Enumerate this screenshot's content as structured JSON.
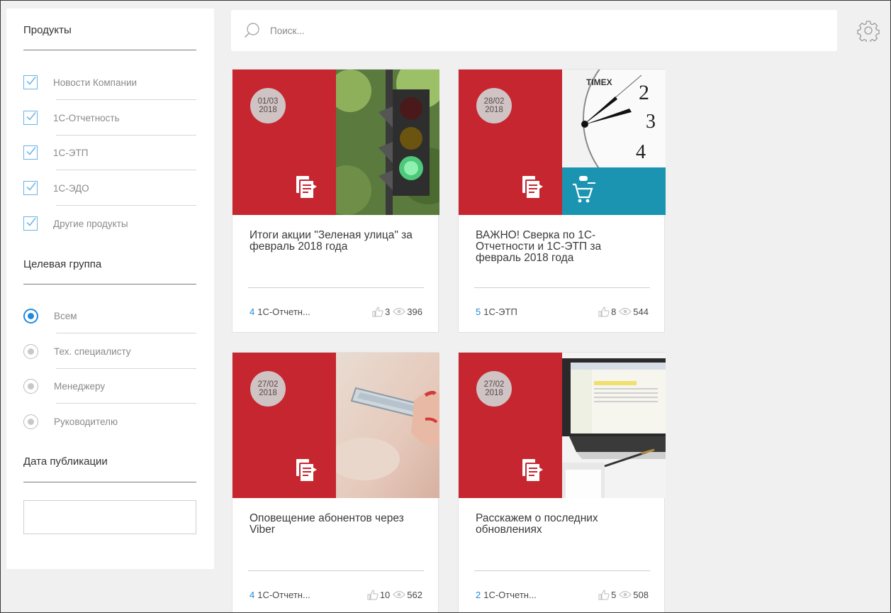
{
  "filters": {
    "products": {
      "title": "Продукты",
      "items": [
        {
          "label": "Новости Компании",
          "checked": true
        },
        {
          "label": "1С-Отчетность",
          "checked": true
        },
        {
          "label": "1С-ЭТП",
          "checked": true
        },
        {
          "label": "1С-ЭДО",
          "checked": true
        },
        {
          "label": "Другие продукты",
          "checked": true
        }
      ]
    },
    "audience": {
      "title": "Целевая группа",
      "options": [
        {
          "label": "Всем",
          "selected": true
        },
        {
          "label": "Тех. специалисту",
          "selected": false
        },
        {
          "label": "Менеджеру",
          "selected": false
        },
        {
          "label": "Руководителю",
          "selected": false
        }
      ]
    },
    "date": {
      "title": "Дата публикации",
      "value": ""
    }
  },
  "search": {
    "placeholder": "Поиск..."
  },
  "icons": {
    "search": "search-icon",
    "settings": "gear-icon",
    "document": "document-icon",
    "cart": "cart-icon",
    "like": "thumbs-up-icon",
    "views": "eye-icon"
  },
  "colors": {
    "card_red": "#c6262f",
    "accent": "#2289e0",
    "cart_teal": "#1a94b0"
  },
  "cards": [
    {
      "day": "01/03",
      "year": "2018",
      "title": "Итоги акции \"Зеленая улица\" за февраль 2018 года",
      "count": "4",
      "tag": "1С-Отчетн...",
      "likes": "3",
      "views": "396",
      "image": "traffic-light-photo"
    },
    {
      "day": "28/02",
      "year": "2018",
      "title": "ВАЖНО! Сверка по 1С-Отчетности и 1С-ЭТП за февраль 2018 года",
      "count": "5",
      "tag": "1С-ЭТП",
      "likes": "8",
      "views": "544",
      "image": "clock-photo"
    },
    {
      "day": "27/02",
      "year": "2018",
      "title": "Оповещение абонентов через Viber",
      "count": "4",
      "tag": "1С-Отчетн...",
      "likes": "10",
      "views": "562",
      "image": "phone-hand-photo"
    },
    {
      "day": "27/02",
      "year": "2018",
      "title": "Расскажем о последних обновлениях",
      "count": "2",
      "tag": "1С-Отчетн...",
      "likes": "5",
      "views": "508",
      "image": "laptop-photo"
    }
  ]
}
